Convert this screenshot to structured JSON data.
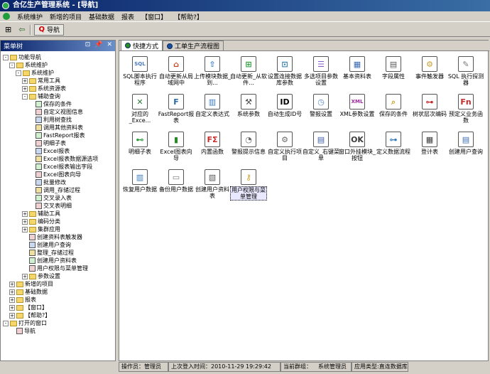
{
  "title": "合亿生产管理系统 - [导航]",
  "menu": [
    "系统维护",
    "新增的项目",
    "基础数据",
    "报表",
    "【窗口】",
    "【帮助?】"
  ],
  "toolbar": {
    "nav_label": "导航"
  },
  "left_panel": {
    "title": "菜单树",
    "controls": [
      "⊡",
      "📌",
      "✕"
    ]
  },
  "tree": [
    {
      "label": "功能导航",
      "level": 0,
      "exp": "-"
    },
    {
      "label": "系统维护",
      "level": 1,
      "exp": "-"
    },
    {
      "label": "系统维护",
      "level": 2,
      "exp": "-"
    },
    {
      "label": "常用工具",
      "level": 3,
      "exp": "+"
    },
    {
      "label": "系统资源表",
      "level": 3,
      "exp": "+"
    },
    {
      "label": "辅助查询",
      "level": 3,
      "exp": "-"
    },
    {
      "label": "保存的条件",
      "level": 4,
      "exp": ""
    },
    {
      "label": "自定义视图信息",
      "level": 4,
      "exp": ""
    },
    {
      "label": "利用树查找",
      "level": 4,
      "exp": ""
    },
    {
      "label": "调用其他资料表",
      "level": 4,
      "exp": ""
    },
    {
      "label": "FastReport报表",
      "level": 4,
      "exp": ""
    },
    {
      "label": "明细子表",
      "level": 4,
      "exp": ""
    },
    {
      "label": "Excel报表",
      "level": 4,
      "exp": ""
    },
    {
      "label": "Excel报表数据源选项",
      "level": 4,
      "exp": ""
    },
    {
      "label": "Excel报表输出字段",
      "level": 4,
      "exp": ""
    },
    {
      "label": "Excel图表向导",
      "level": 4,
      "exp": ""
    },
    {
      "label": "批量修改",
      "level": 4,
      "exp": ""
    },
    {
      "label": "调用_存储过程",
      "level": 4,
      "exp": ""
    },
    {
      "label": "交叉录入表",
      "level": 4,
      "exp": ""
    },
    {
      "label": "交叉表明细",
      "level": 4,
      "exp": ""
    },
    {
      "label": "辅助工具",
      "level": 3,
      "exp": "+"
    },
    {
      "label": "编码分类",
      "level": 3,
      "exp": "+"
    },
    {
      "label": "集群应用",
      "level": 3,
      "exp": "+"
    },
    {
      "label": "创建资料表触发器",
      "level": 3,
      "exp": ""
    },
    {
      "label": "创建用户查询",
      "level": 3,
      "exp": ""
    },
    {
      "label": "整理_存储过程",
      "level": 3,
      "exp": ""
    },
    {
      "label": "创建用户资料表",
      "level": 3,
      "exp": ""
    },
    {
      "label": "用户权限与菜单管理",
      "level": 3,
      "exp": ""
    },
    {
      "label": "参数设置",
      "level": 3,
      "exp": "+"
    },
    {
      "label": "新增的项目",
      "level": 1,
      "exp": "+"
    },
    {
      "label": "基础数据",
      "level": 1,
      "exp": "+"
    },
    {
      "label": "报表",
      "level": 1,
      "exp": "+"
    },
    {
      "label": "【窗口】",
      "level": 1,
      "exp": "+"
    },
    {
      "label": "【帮助?】",
      "level": 1,
      "exp": "+"
    },
    {
      "label": "打开的窗口",
      "level": 0,
      "exp": "-"
    },
    {
      "label": "导航",
      "level": 1,
      "exp": ""
    }
  ],
  "tabs": [
    "快捷方式",
    "工单生产流程图"
  ],
  "icons": [
    {
      "label": "SQL脚本执行程序",
      "sym": "SQL",
      "color": "#4a78c0"
    },
    {
      "label": "自动更新从局域网中",
      "sym": "⌂",
      "color": "#c84a2a"
    },
    {
      "label": "上传模块数据_到...",
      "sym": "⇧",
      "color": "#3a80c8"
    },
    {
      "label": "自动更新_从软件...",
      "sym": "⊞",
      "color": "#2a9a3a"
    },
    {
      "label": "设置连接数据库参数",
      "sym": "⊡",
      "color": "#2a7ab0"
    },
    {
      "label": "多选项目参数设置",
      "sym": "☰",
      "color": "#8a5ac8"
    },
    {
      "label": "基本资料表",
      "sym": "▦",
      "color": "#3a6ab0"
    },
    {
      "label": "字段属性",
      "sym": "▤",
      "color": "#5a5a5a"
    },
    {
      "label": "事件触发器",
      "sym": "⚙",
      "color": "#c8a02a"
    },
    {
      "label": "SQL 执行探测器",
      "sym": "✎",
      "color": "#7a7a7a"
    },
    {
      "label": "对应的_Exce...",
      "sym": "✕",
      "color": "#2a7a3a"
    },
    {
      "label": "FastReport报表",
      "sym": "F",
      "color": "#2a6aa0"
    },
    {
      "label": "自定义表达式",
      "sym": "▥",
      "color": "#3a7ac0"
    },
    {
      "label": "系统参数",
      "sym": "⚒",
      "color": "#4a4a4a"
    },
    {
      "label": "自动生成ID号",
      "sym": "ID",
      "color": "#000000"
    },
    {
      "label": "警报设置",
      "sym": "◷",
      "color": "#5a8ac8"
    },
    {
      "label": "XML参数设置",
      "sym": "XML",
      "color": "#a02aa0"
    },
    {
      "label": "保存的条件",
      "sym": "⌕",
      "color": "#c8a02a"
    },
    {
      "label": "树状层次编码",
      "sym": "⊶",
      "color": "#c82a2a"
    },
    {
      "label": "预定义业务函数",
      "sym": "Fn",
      "color": "#c82a2a"
    },
    {
      "label": "明细子表",
      "sym": "⊷",
      "color": "#2a9a3a"
    },
    {
      "label": "Excel图表向导",
      "sym": "▮",
      "color": "#2a8a2a"
    },
    {
      "label": "内置函数",
      "sym": "FΣ",
      "color": "#c82a2a"
    },
    {
      "label": "警报提示信息",
      "sym": "◔",
      "color": "#6a6a6a"
    },
    {
      "label": "自定义执行项目",
      "sym": "⚙",
      "color": "#6a6a6a"
    },
    {
      "label": "自定义_右键菜单",
      "sym": "▤",
      "color": "#3a5aa0"
    },
    {
      "label": "窗口外挂模块_按钮",
      "sym": "OK",
      "color": "#3a3a3a"
    },
    {
      "label": "定义数据流程",
      "sym": "⊶",
      "color": "#3a7ac0"
    },
    {
      "label": "登计表",
      "sym": "▦",
      "color": "#3a3a3a"
    },
    {
      "label": "创建用户查询",
      "sym": "▤",
      "color": "#3a6ab0"
    },
    {
      "label": "恢复用户数据",
      "sym": "▥",
      "color": "#3a7ac0"
    },
    {
      "label": "备份用户数据",
      "sym": "▭",
      "color": "#7a7a7a"
    },
    {
      "label": "创建用户资料表",
      "sym": "▧",
      "color": "#5a5a5a"
    },
    {
      "label": "用户权限与菜单管理",
      "sym": "⚷",
      "color": "#c8a02a"
    }
  ],
  "status": {
    "operator": "操作员：管理员",
    "last_login": "上次登入时间：2010-11-29 19:29:42",
    "group_label": "当前群组：",
    "group": "系统管理员",
    "app_type": "应用类型:直连数据库"
  }
}
